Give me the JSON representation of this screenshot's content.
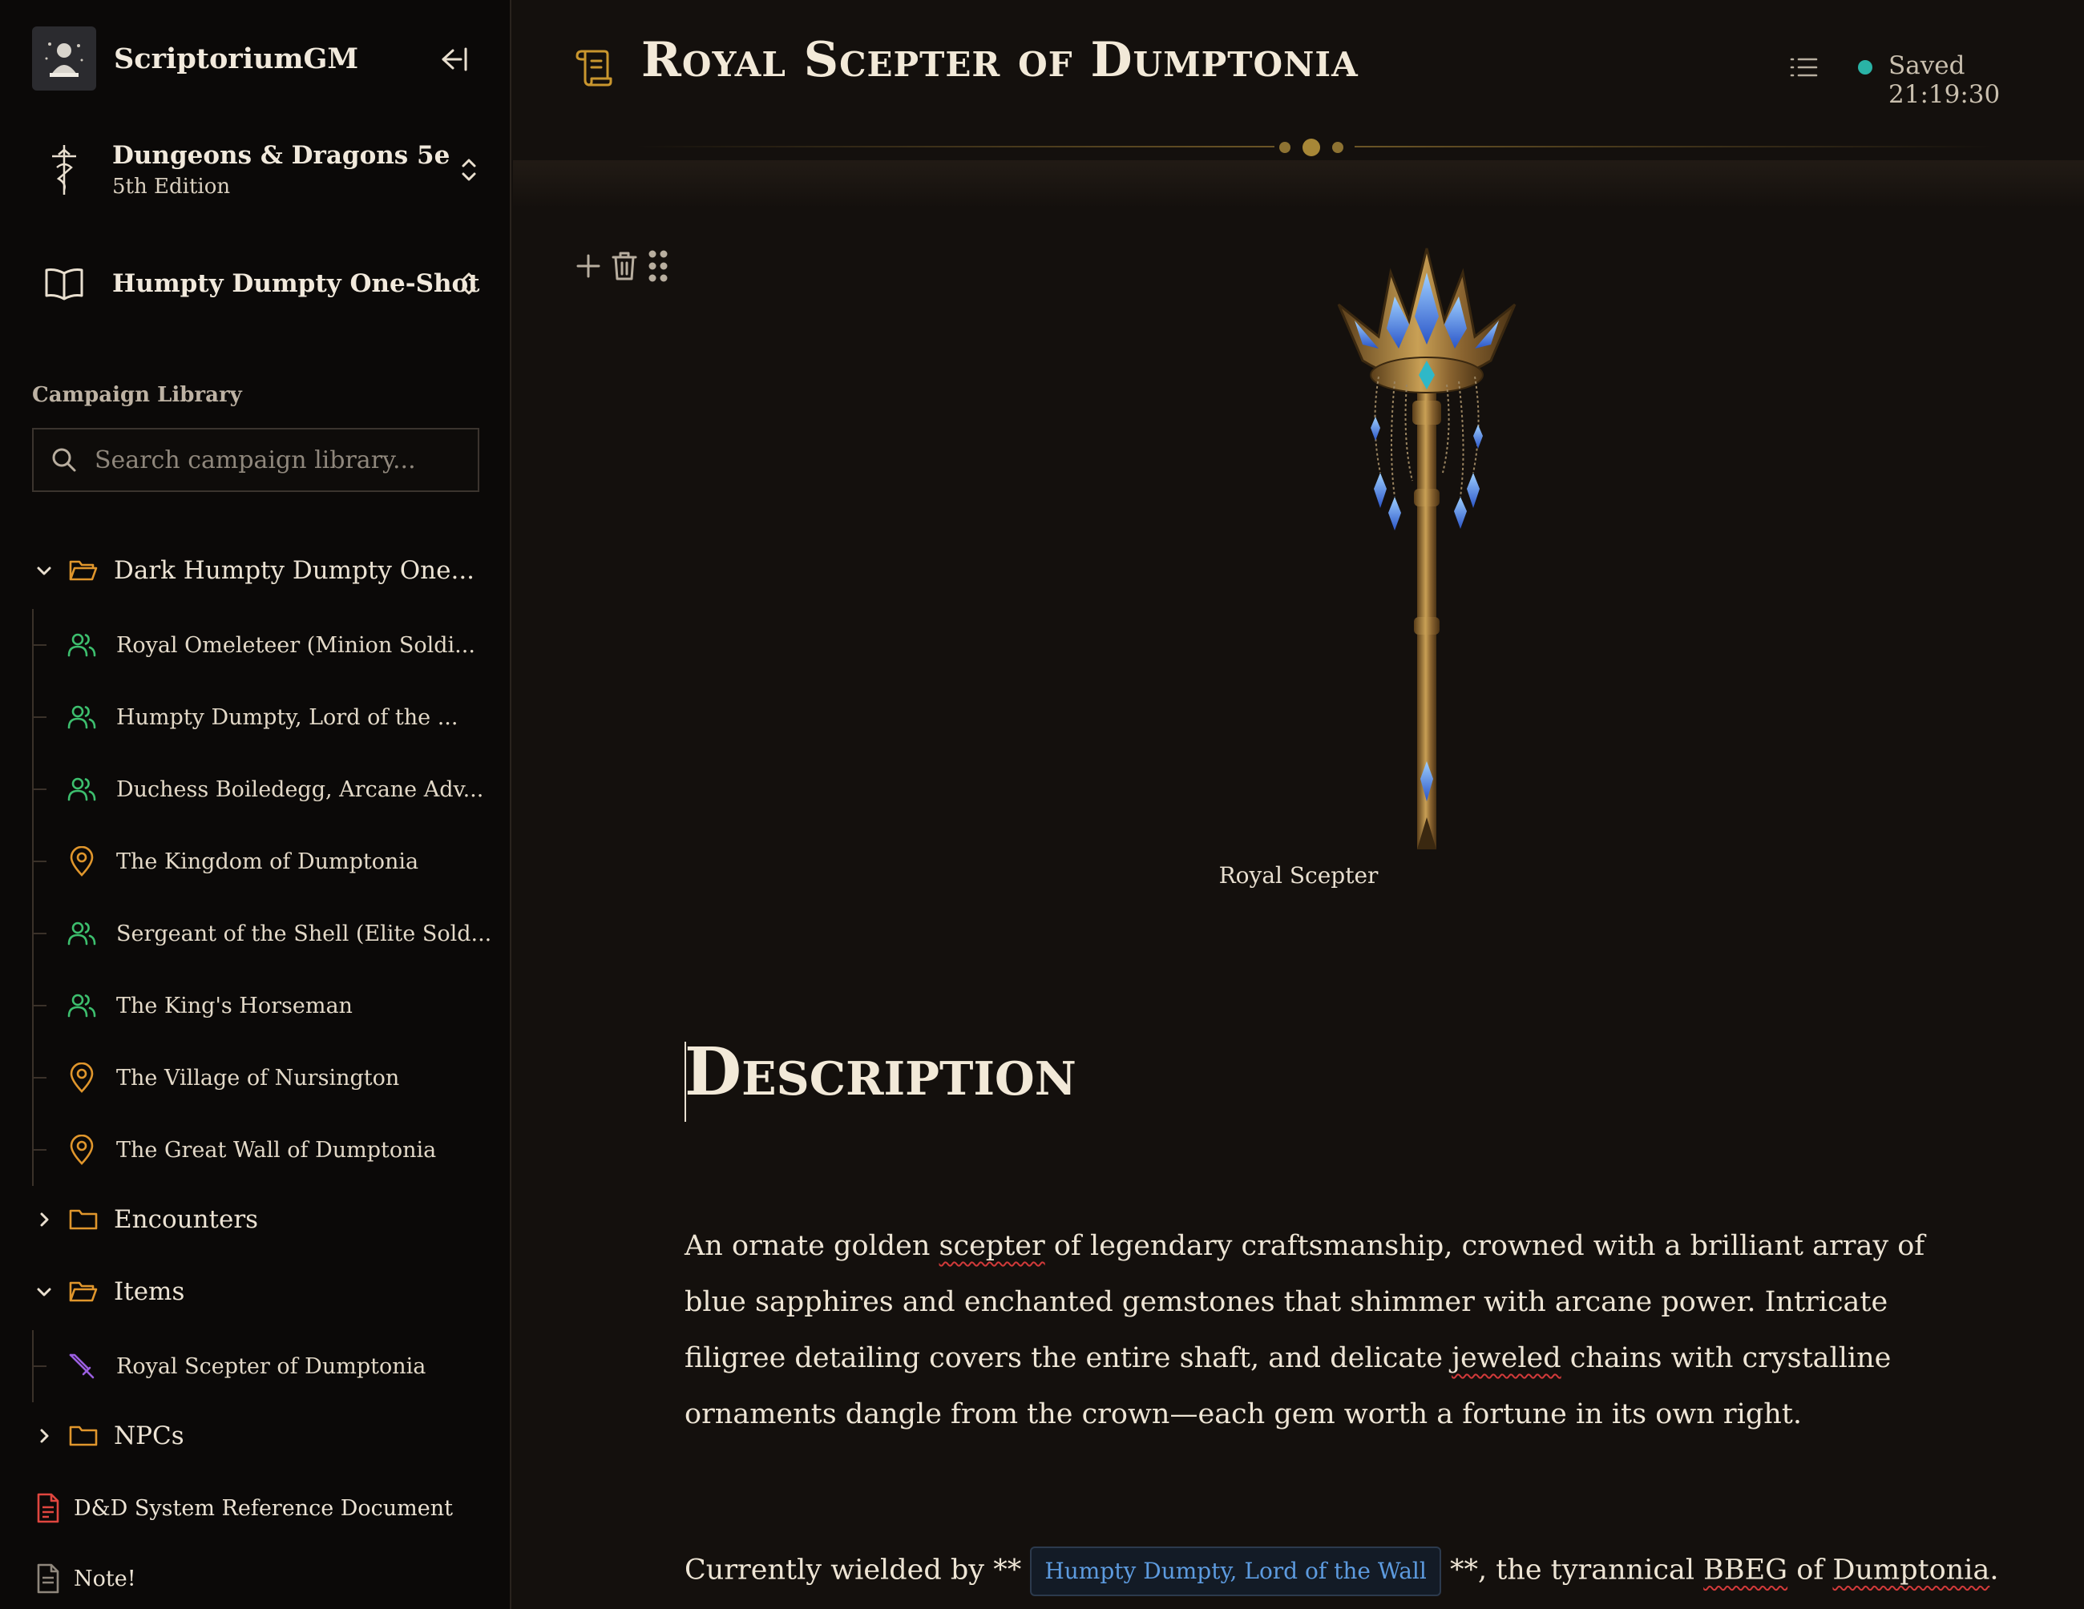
{
  "app": {
    "name": "ScriptoriumGM"
  },
  "system_selector": {
    "title": "Dungeons & Dragons 5e",
    "subtitle": "5th Edition"
  },
  "campaign_selector": {
    "title": "Humpty Dumpty One-Shot"
  },
  "library": {
    "label": "Campaign Library",
    "search_placeholder": "Search campaign library...",
    "folders": [
      {
        "label": "Dark Humpty Dumpty One...",
        "expanded": true,
        "items": [
          {
            "label": "Royal Omeleteer (Minion Soldi...",
            "icon": "users-icon"
          },
          {
            "label": "Humpty Dumpty, Lord of the ...",
            "icon": "users-icon"
          },
          {
            "label": "Duchess Boiledegg, Arcane Adv...",
            "icon": "users-icon"
          },
          {
            "label": "The Kingdom of Dumptonia",
            "icon": "map-pin-icon"
          },
          {
            "label": "Sergeant of the Shell (Elite Sold...",
            "icon": "users-icon"
          },
          {
            "label": "The King's Horseman",
            "icon": "users-icon"
          },
          {
            "label": "The Village of Nursington",
            "icon": "map-pin-icon"
          },
          {
            "label": "The Great Wall of Dumptonia",
            "icon": "map-pin-icon"
          }
        ]
      },
      {
        "label": "Encounters",
        "expanded": false
      },
      {
        "label": "Items",
        "expanded": true,
        "items": [
          {
            "label": "Royal Scepter of Dumptonia",
            "icon": "sword-icon"
          }
        ]
      },
      {
        "label": "NPCs",
        "expanded": false
      }
    ],
    "documents": [
      {
        "label": "D&D System Reference Document",
        "icon": "document-icon"
      },
      {
        "label": "Note!",
        "icon": "note-icon"
      }
    ]
  },
  "page": {
    "title": "Royal Scepter of Dumptonia",
    "status": "Saved 21:19:30",
    "image_caption": "Royal Scepter",
    "heading": "Description",
    "description_parts": [
      "An ornate golden ",
      "scepter",
      " of legendary craftsmanship, crowned with a brilliant array of blue sapphires and enchanted gemstones that shimmer with arcane power. Intricate filigree detailing covers the entire shaft, and delicate ",
      "jeweled",
      " chains with crystalline ornaments dangle from the crown—each gem worth a fortune in its own right."
    ],
    "wielder_parts": {
      "prefix": "Currently wielded by ** ",
      "mention": "Humpty Dumpty, Lord of the Wall",
      "middle": " **, the tyrannical ",
      "word1": "BBEG",
      "of": " of ",
      "word2": "Dumptonia",
      "end": "."
    }
  },
  "colors": {
    "background": "#14100d",
    "sidebar": "#0b0908",
    "accent_gold": "#c9962e",
    "npc_green": "#3dbf6e",
    "location_orange": "#e0962c",
    "item_purple": "#9b5fe0",
    "doc_red": "#e0463f",
    "link_blue": "#5d9bdf",
    "status_teal": "#2ab3a6"
  }
}
